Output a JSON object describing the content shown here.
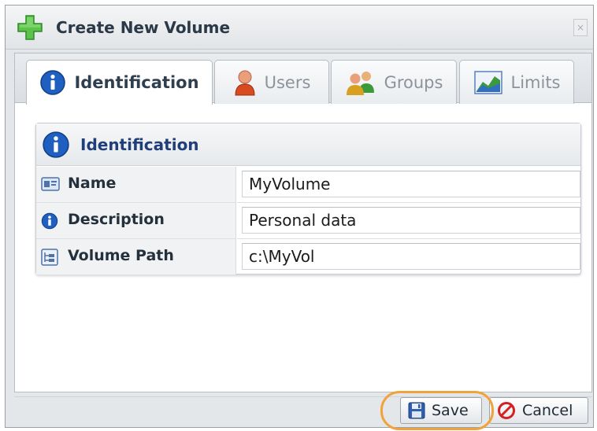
{
  "dialog": {
    "title": "Create New Volume",
    "close_icon": "close-icon",
    "title_icon": "plus-icon",
    "accent_color": "#2b5ea8",
    "highlight_color": "#f0a23c"
  },
  "tabs": [
    {
      "label": "Identification",
      "icon": "info-icon",
      "active": true
    },
    {
      "label": "Users",
      "icon": "user-icon",
      "active": false
    },
    {
      "label": "Groups",
      "icon": "group-icon",
      "active": false
    },
    {
      "label": "Limits",
      "icon": "chart-icon",
      "active": false
    }
  ],
  "section": {
    "title": "Identification",
    "fields": [
      {
        "label": "Name",
        "icon": "card-icon",
        "value": "MyVolume"
      },
      {
        "label": "Description",
        "icon": "info-icon",
        "value": "Personal data"
      },
      {
        "label": "Volume Path",
        "icon": "folder-tree-icon",
        "value": "c:\\MyVol"
      }
    ]
  },
  "footer": {
    "save_label": "Save",
    "cancel_label": "Cancel"
  }
}
